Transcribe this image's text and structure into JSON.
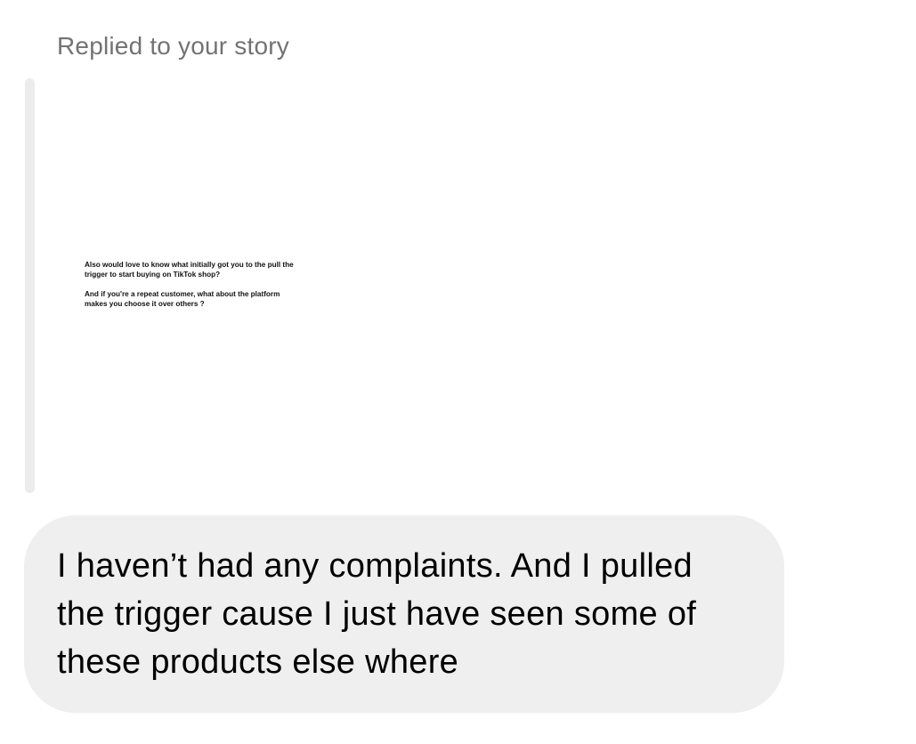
{
  "reply": {
    "label": "Replied to your story"
  },
  "story": {
    "line1": "Also would love to know what initially got you to the pull the trigger to start buying on TikTok shop?",
    "line2": "And if you're a repeat customer, what about the platform makes you choose it over others ?"
  },
  "message": {
    "text": "I haven’t had any complaints. And I pulled the trigger cause I just have seen some of these products else where"
  }
}
